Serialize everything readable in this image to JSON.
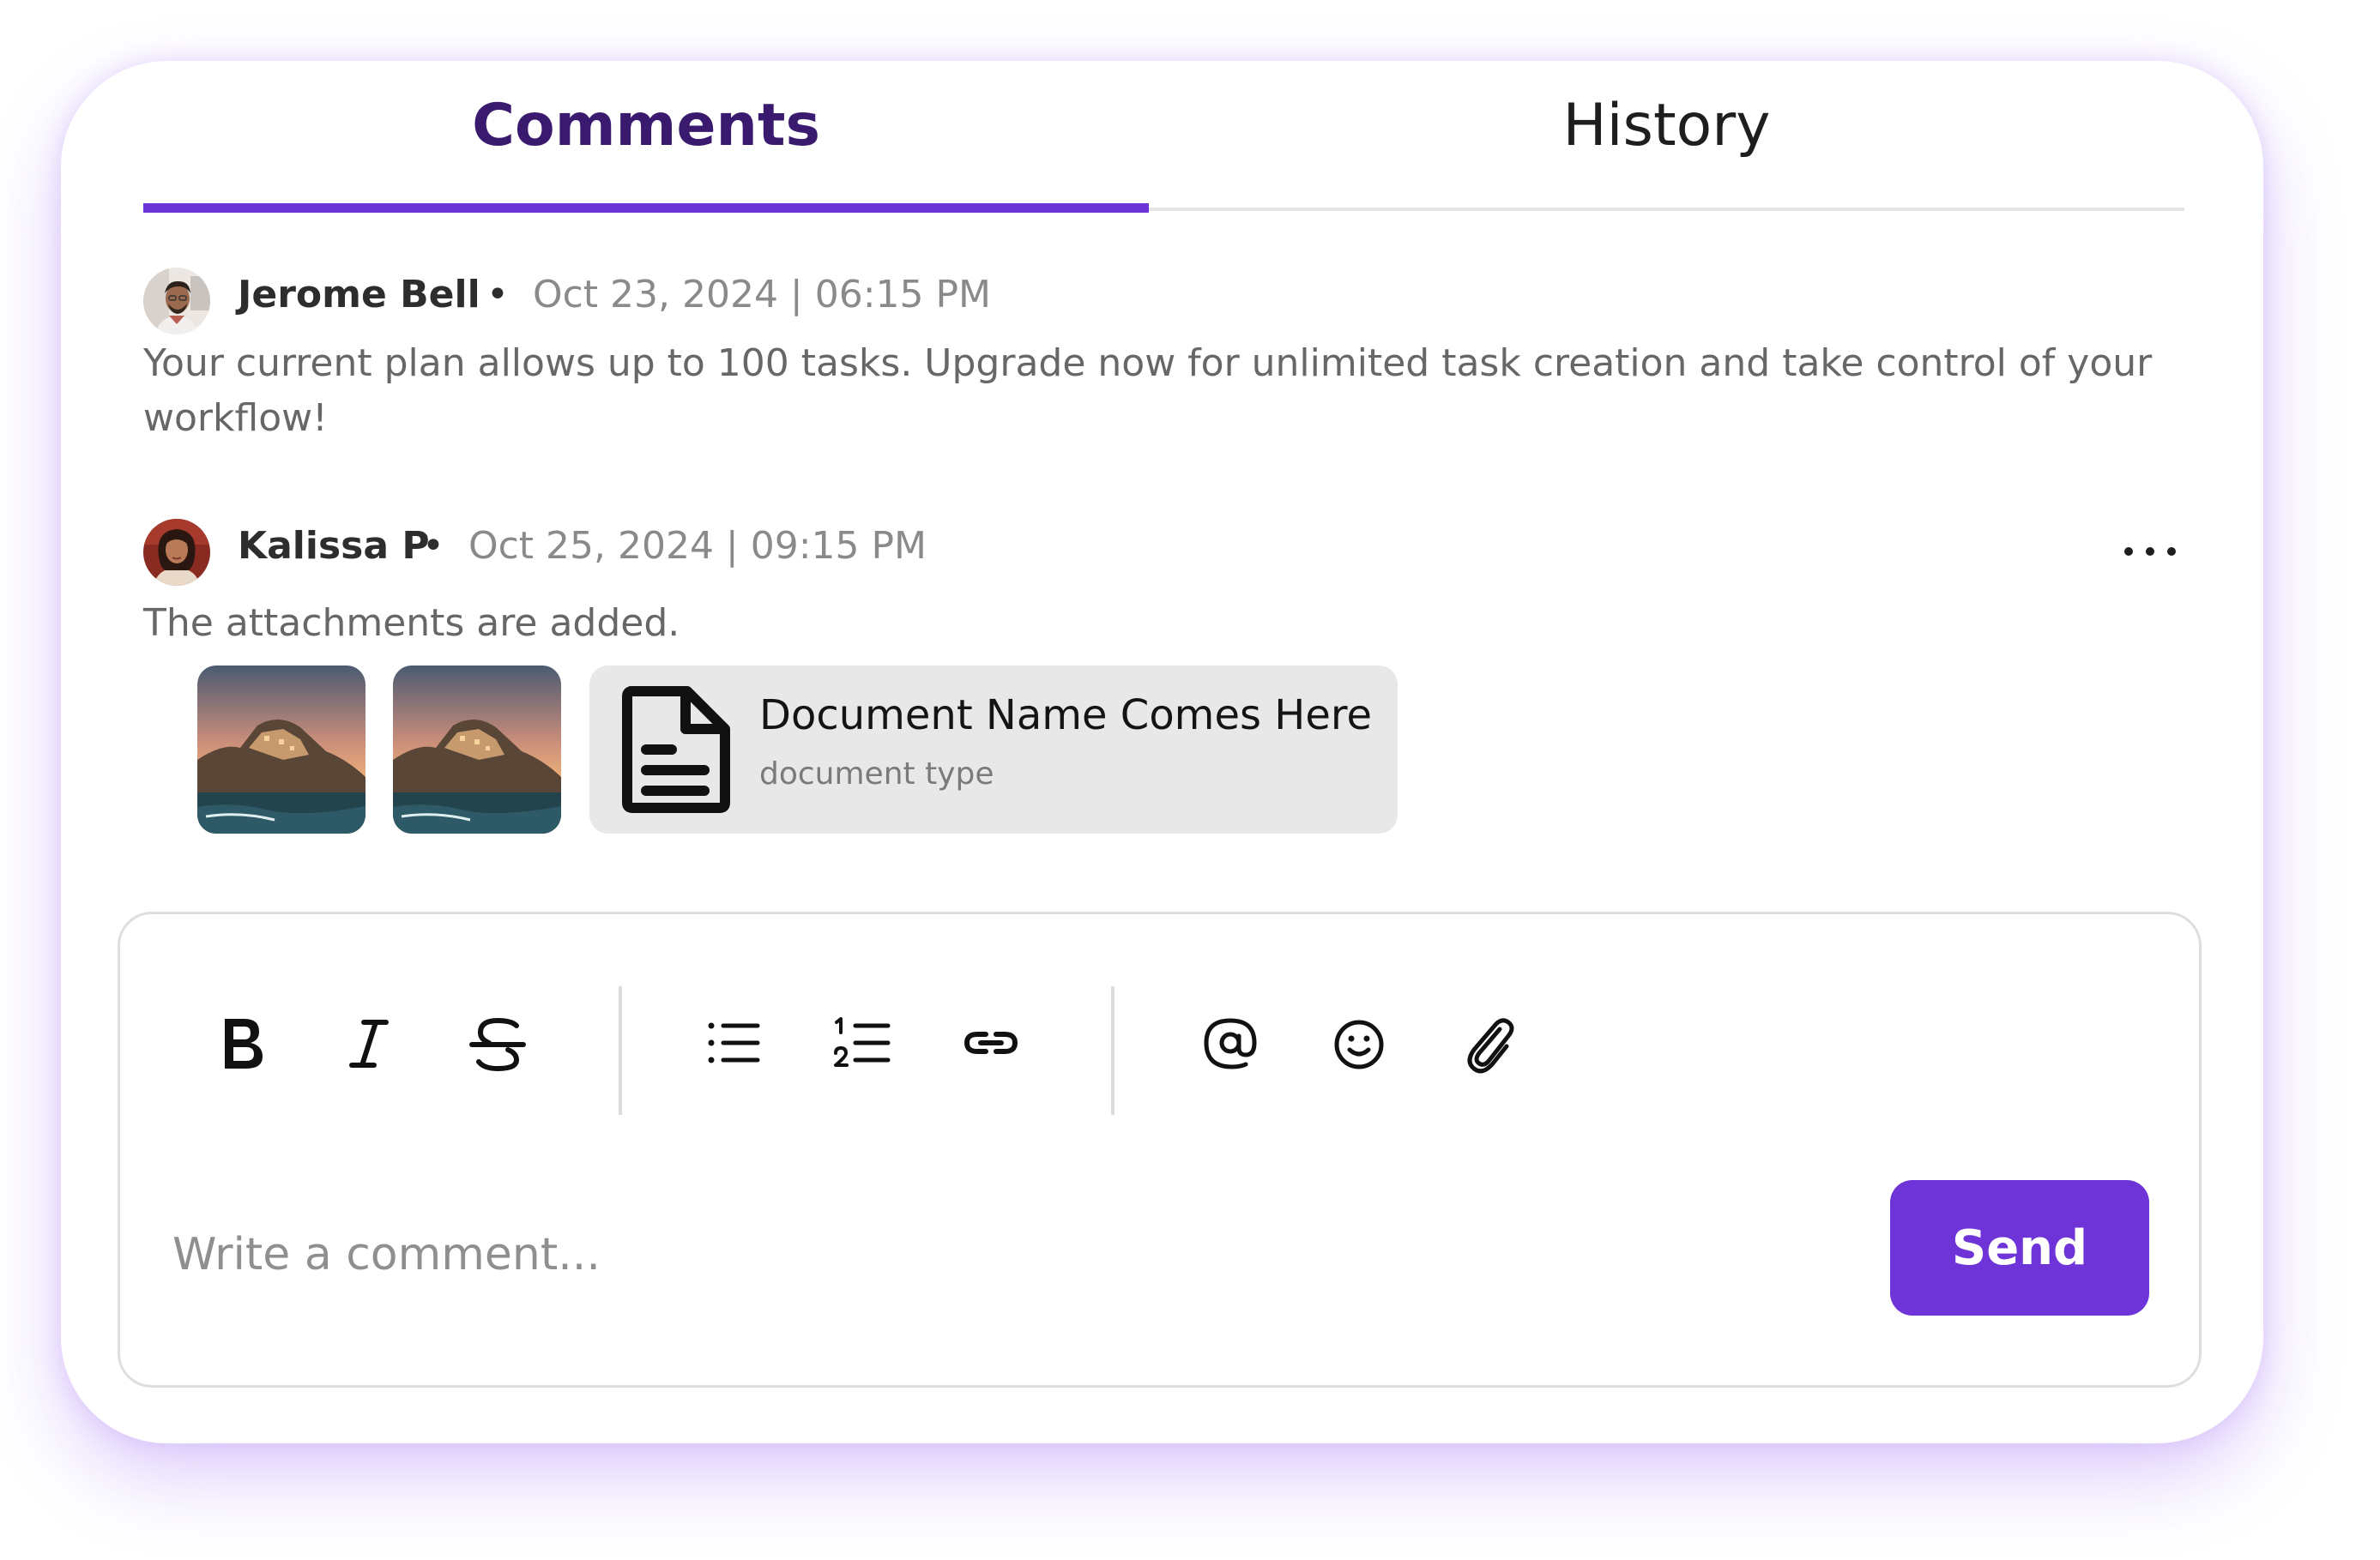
{
  "tabs": [
    {
      "label": "Comments",
      "active": true
    },
    {
      "label": "History",
      "active": false
    }
  ],
  "comments": [
    {
      "author": "Jerome Bell",
      "separator": "•",
      "timestamp": "Oct 23, 2024 | 06:15 PM",
      "text": "Your current plan allows up to 100 tasks. Upgrade now for unlimited task creation and take control of your workflow!",
      "avatar": "avatar-photo-man"
    },
    {
      "author": "Kalissa P",
      "separator": "•",
      "timestamp": "Oct 25, 2024 | 09:15 PM",
      "text": "The attachments are added.",
      "avatar": "avatar-photo-woman",
      "attachments": {
        "images": [
          "landscape-photo",
          "landscape-photo"
        ],
        "document": {
          "name": "Document Name Comes Here",
          "type": "document type",
          "icon": "document-icon"
        }
      },
      "menu_icon": "more-horizontal-icon"
    }
  ],
  "editor": {
    "toolbar": [
      "bold-icon",
      "italic-icon",
      "strikethrough-icon",
      "bulleted-list-icon",
      "numbered-list-icon",
      "link-icon",
      "mention-icon",
      "emoji-icon",
      "attachment-icon"
    ],
    "placeholder": "Write a comment...",
    "value": "",
    "send_label": "Send"
  },
  "colors": {
    "accent": "#6E34D8",
    "active_tab_text": "#3A1A6E",
    "timestamp": "#8A8A8A",
    "body_text": "#676767",
    "attachment_bg": "#E8E8E8",
    "shadow": "#B58CFF"
  }
}
